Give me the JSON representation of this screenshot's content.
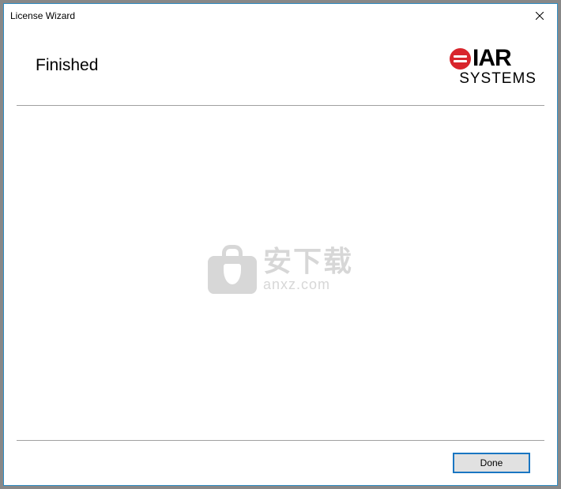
{
  "window": {
    "title": "License Wizard"
  },
  "header": {
    "heading": "Finished"
  },
  "logo": {
    "line1": "IAR",
    "line2": "SYSTEMS"
  },
  "watermark": {
    "cn": "安下载",
    "en": "anxz.com"
  },
  "footer": {
    "done_label": "Done"
  }
}
